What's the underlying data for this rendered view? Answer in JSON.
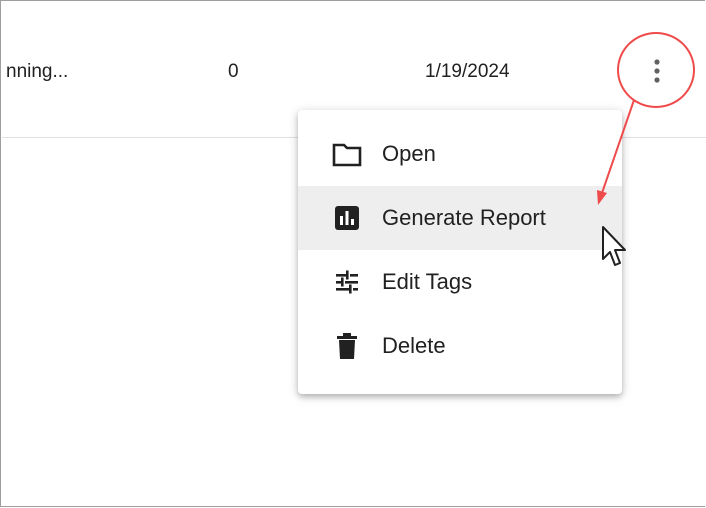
{
  "table": {
    "row": {
      "status": "nning...",
      "count": "0",
      "date": "1/19/2024"
    }
  },
  "actions_button": {
    "icon": "more-vertical-icon"
  },
  "context_menu": {
    "items": [
      {
        "label": "Open",
        "icon": "folder-icon"
      },
      {
        "label": "Generate Report",
        "icon": "report-chart-icon"
      },
      {
        "label": "Edit Tags",
        "icon": "tune-sliders-icon"
      },
      {
        "label": "Delete",
        "icon": "trash-icon"
      }
    ],
    "hovered_item": "Generate Report"
  },
  "annotation": {
    "color": "#ef4b4b"
  }
}
